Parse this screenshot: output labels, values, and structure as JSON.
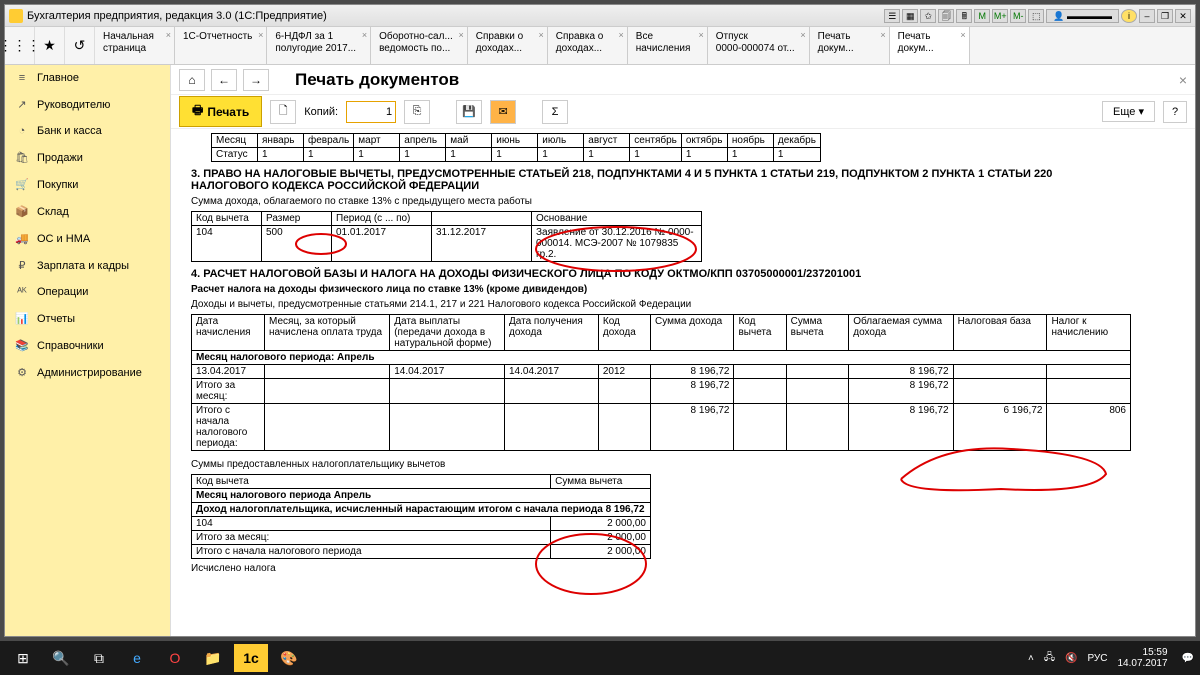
{
  "window": {
    "title": "Бухгалтерия предприятия, редакция 3.0  (1С:Предприятие)"
  },
  "tabs": [
    {
      "l1": "Начальная",
      "l2": "страница"
    },
    {
      "l1": "1С-Отчетность",
      "l2": ""
    },
    {
      "l1": "6-НДФЛ за 1",
      "l2": "полугодие 2017..."
    },
    {
      "l1": "Оборотно-сал...",
      "l2": "ведомость по..."
    },
    {
      "l1": "Справки о",
      "l2": "доходах..."
    },
    {
      "l1": "Справка о",
      "l2": "доходах..."
    },
    {
      "l1": "Все",
      "l2": "начисления"
    },
    {
      "l1": "Отпуск",
      "l2": "0000-000074 от..."
    },
    {
      "l1": "Печать",
      "l2": "докум..."
    },
    {
      "l1": "Печать",
      "l2": "докум..."
    }
  ],
  "sidebar": [
    {
      "icon": "≡",
      "label": "Главное"
    },
    {
      "icon": "↗",
      "label": "Руководителю"
    },
    {
      "icon": "◔",
      "label": "Банк и касса"
    },
    {
      "icon": "🛍",
      "label": "Продажи"
    },
    {
      "icon": "🛒",
      "label": "Покупки"
    },
    {
      "icon": "📦",
      "label": "Склад"
    },
    {
      "icon": "🚚",
      "label": "ОС и НМА"
    },
    {
      "icon": "₽",
      "label": "Зарплата и кадры"
    },
    {
      "icon": "ᴬᴷ",
      "label": "Операции"
    },
    {
      "icon": "📊",
      "label": "Отчеты"
    },
    {
      "icon": "📚",
      "label": "Справочники"
    },
    {
      "icon": "⚙",
      "label": "Администрирование"
    }
  ],
  "page": {
    "title": "Печать документов"
  },
  "toolbar": {
    "print": "Печать",
    "copies_label": "Копий:",
    "copies_value": "1",
    "more": "Еще",
    "help": "?"
  },
  "months_header": [
    "Месяц",
    "январь",
    "февраль",
    "март",
    "апрель",
    "май",
    "июнь",
    "июль",
    "август",
    "сентябрь",
    "октябрь",
    "ноябрь",
    "декабрь"
  ],
  "months_status_label": "Статус",
  "months_status": [
    "1",
    "1",
    "1",
    "1",
    "1",
    "1",
    "1",
    "1",
    "1",
    "1",
    "1",
    "1"
  ],
  "section3": {
    "title": "3. ПРАВО НА НАЛОГОВЫЕ ВЫЧЕТЫ, ПРЕДУСМОТРЕННЫЕ СТАТЬЕЙ  218, ПОДПУНКТАМИ 4 И 5 ПУНКТА 1 СТАТЬИ 219, ПОДПУНКТОМ 2 ПУНКТА 1 СТАТЬИ 220 НАЛОГОВОГО КОДЕКСА РОССИЙСКОЙ ФЕДЕРАЦИИ",
    "subtitle": "Сумма дохода, облагаемого по ставке 13% с предыдущего места работы",
    "headers": [
      "Код вычета",
      "Размер",
      "Период (с ... по)",
      "",
      "Основание"
    ],
    "row": [
      "104",
      "500",
      "01.01.2017",
      "31.12.2017",
      "Заявление от 30.12.2016 № 0000-000014. МСЭ-2007 № 1079835 гр.2."
    ]
  },
  "section4": {
    "title": "4. РАСЧЕТ НАЛОГОВОЙ БАЗЫ И НАЛОГА НА ДОХОДЫ ФИЗИЧЕСКОГО ЛИЦА ПО КОДУ ОКТМО/КПП 03705000001/237201001",
    "sub1": "Расчет налога на доходы физического лица по ставке 13% (кроме дивидендов)",
    "sub2": "Доходы и вычеты, предусмотренные статьями 214.1, 217 и 221 Налогового кодекса Российской Федерации",
    "headers": [
      "Дата начисления",
      "Месяц, за который начислена оплата труда",
      "Дата выплаты (передачи дохода в натуральной форме)",
      "Дата получения дохода",
      "Код дохода",
      "Сумма дохода",
      "Код вычета",
      "Сумма вычета",
      "Облагаемая сумма дохода",
      "Налоговая база",
      "Налог к начислению"
    ],
    "period_row": "Месяц налогового периода: Апрель",
    "rows": [
      [
        "13.04.2017",
        "",
        "14.04.2017",
        "14.04.2017",
        "2012",
        "8 196,72",
        "",
        "",
        "8 196,72",
        "",
        ""
      ],
      [
        "Итого за месяц:",
        "",
        "",
        "",
        "",
        "8 196,72",
        "",
        "",
        "8 196,72",
        "",
        ""
      ],
      [
        "Итого с начала налогового периода:",
        "",
        "",
        "",
        "",
        "8 196,72",
        "",
        "",
        "8 196,72",
        "6 196,72",
        "806"
      ]
    ],
    "deduct_title": "Суммы предоставленных налогоплательщику вычетов",
    "deduct_headers": [
      "Код вычета",
      "Сумма вычета"
    ],
    "deduct_period": "Месяц налогового периода Апрель",
    "deduct_income": "Доход налогоплательщика, исчисленный нарастающим итогом с начала периода 8 196,72",
    "deduct_rows": [
      [
        "104",
        "2 000,00"
      ],
      [
        "Итого за месяц:",
        "2 000,00"
      ],
      [
        "Итого с начала налогового периода",
        "2 000,00"
      ]
    ],
    "foot": "Исчислено налога"
  },
  "taskbar": {
    "lang": "РУС",
    "time": "15:59",
    "date": "14.07.2017"
  }
}
